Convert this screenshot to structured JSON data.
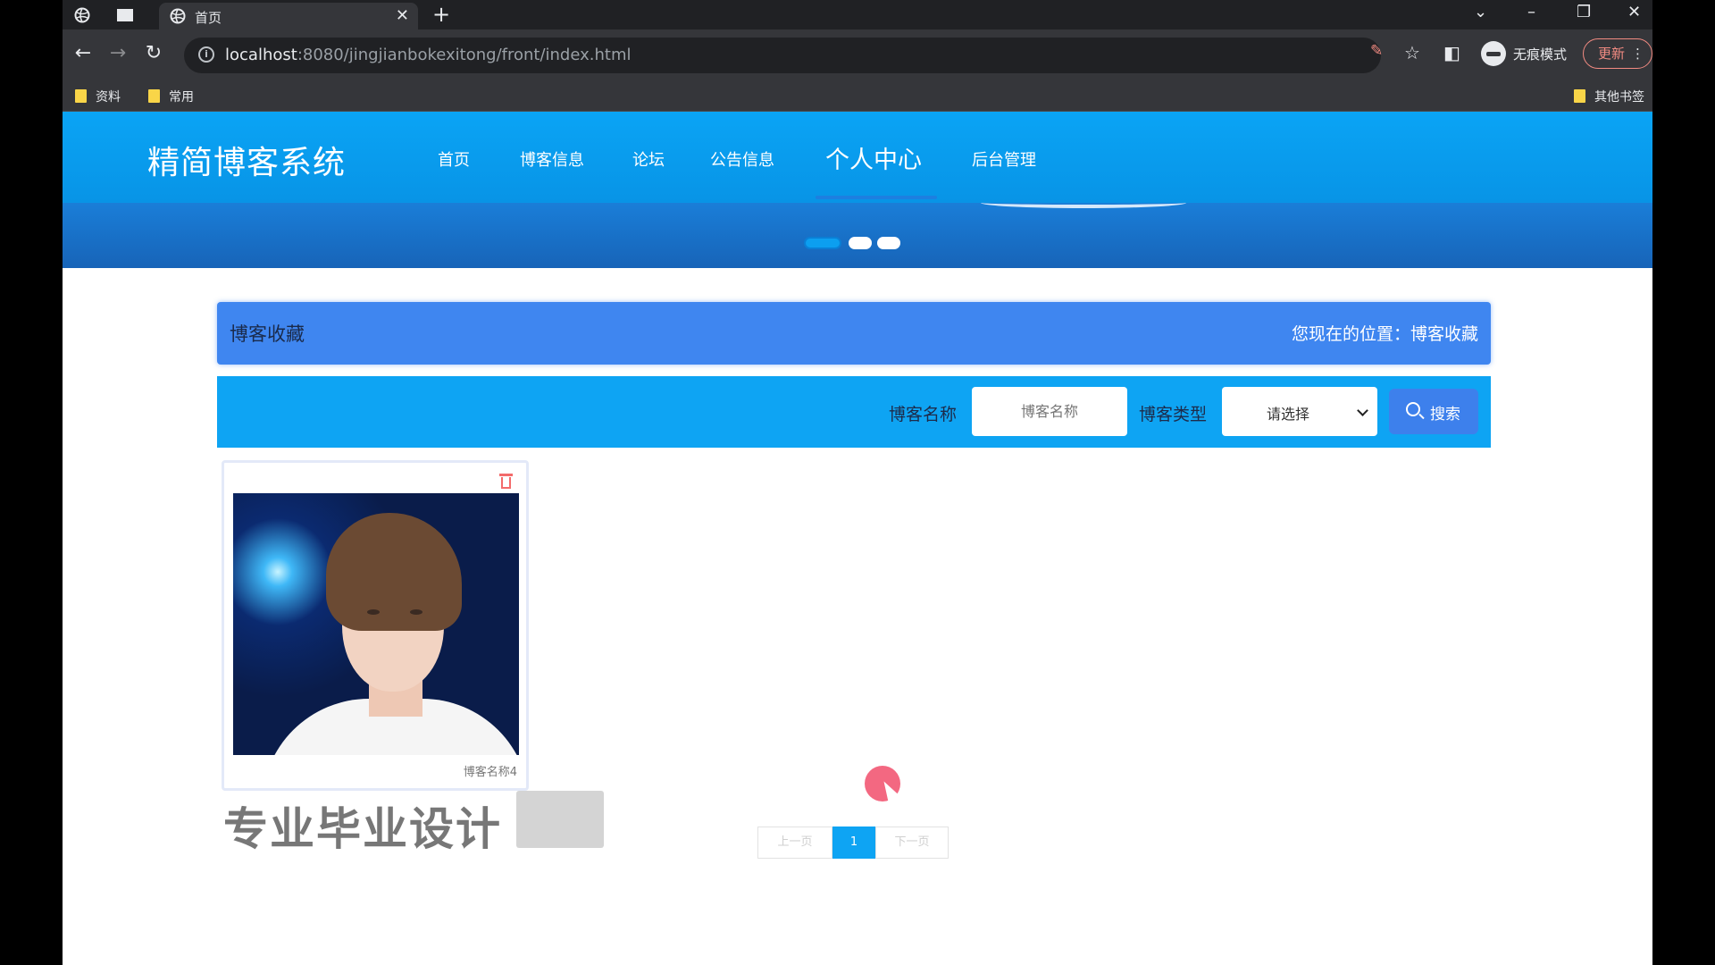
{
  "browser": {
    "tab_title": "首页",
    "url_host": "localhost",
    "url_path": ":8080/jingjianbokexitong/front/index.html",
    "incognito_label": "无痕模式",
    "update_label": "更新",
    "bookmarks": [
      "资料",
      "常用"
    ],
    "other_bookmarks": "其他书签"
  },
  "site": {
    "logo": "精简博客系统",
    "nav": [
      "首页",
      "博客信息",
      "论坛",
      "公告信息",
      "个人中心",
      "后台管理"
    ],
    "active_nav": "个人中心"
  },
  "section": {
    "title": "博客收藏",
    "location": "您现在的位置：博客收藏"
  },
  "search": {
    "name_label": "博客名称",
    "name_placeholder": "博客名称",
    "type_label": "博客类型",
    "type_selected": "请选择",
    "button": "搜索"
  },
  "cards": [
    {
      "name": "博客名称4"
    }
  ],
  "watermark": "专业毕业设计",
  "pagination": {
    "prev": "上一页",
    "current": "1",
    "next": "下一页"
  },
  "colors": {
    "header": "#0aa4f5",
    "title_bar": "#3f86f0",
    "search_bar": "#0ea4f3",
    "search_button": "#3d80ec",
    "delete_icon": "#f36b6b"
  }
}
